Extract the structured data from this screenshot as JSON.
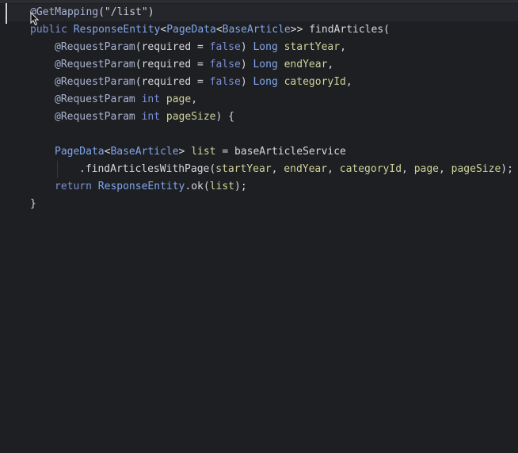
{
  "editor": {
    "language": "java",
    "lines": [
      {
        "tokens": [
          [
            "an",
            "@GetMapping"
          ],
          [
            "fn",
            "("
          ],
          [
            "st",
            "\"/list\""
          ],
          [
            "fn",
            ")"
          ]
        ]
      },
      {
        "tokens": [
          [
            "kw",
            "public "
          ],
          [
            "ty",
            "ResponseEntity"
          ],
          [
            "fn",
            "<"
          ],
          [
            "ty",
            "PageData"
          ],
          [
            "fn",
            "<"
          ],
          [
            "ty",
            "BaseArticle"
          ],
          [
            "fn",
            ">> findArticles("
          ]
        ]
      },
      {
        "indent": 1,
        "tokens": [
          [
            "an",
            "@RequestParam"
          ],
          [
            "fn",
            "(required = "
          ],
          [
            "kw",
            "false"
          ],
          [
            "fn",
            ") "
          ],
          [
            "ty",
            "Long "
          ],
          [
            "pa",
            "startYear"
          ],
          [
            "fn",
            ","
          ]
        ]
      },
      {
        "indent": 1,
        "tokens": [
          [
            "an",
            "@RequestParam"
          ],
          [
            "fn",
            "(required = "
          ],
          [
            "kw",
            "false"
          ],
          [
            "fn",
            ") "
          ],
          [
            "ty",
            "Long "
          ],
          [
            "pa",
            "endYear"
          ],
          [
            "fn",
            ","
          ]
        ]
      },
      {
        "indent": 1,
        "tokens": [
          [
            "an",
            "@RequestParam"
          ],
          [
            "fn",
            "(required = "
          ],
          [
            "kw",
            "false"
          ],
          [
            "fn",
            ") "
          ],
          [
            "ty",
            "Long "
          ],
          [
            "pa",
            "categoryId"
          ],
          [
            "fn",
            ","
          ]
        ]
      },
      {
        "indent": 1,
        "tokens": [
          [
            "an",
            "@RequestParam "
          ],
          [
            "kw",
            "int "
          ],
          [
            "pa",
            "page"
          ],
          [
            "fn",
            ","
          ]
        ]
      },
      {
        "indent": 1,
        "tokens": [
          [
            "an",
            "@RequestParam "
          ],
          [
            "kw",
            "int "
          ],
          [
            "pa",
            "pageSize"
          ],
          [
            "fn",
            ") {"
          ]
        ]
      },
      {
        "tokens": []
      },
      {
        "indent": 1,
        "tokens": [
          [
            "ty",
            "PageData"
          ],
          [
            "fn",
            "<"
          ],
          [
            "ty",
            "BaseArticle"
          ],
          [
            "fn",
            "> "
          ],
          [
            "pa",
            "list"
          ],
          [
            "fn",
            " = baseArticleService"
          ]
        ]
      },
      {
        "indent": 2,
        "guide": true,
        "tokens": [
          [
            "fn",
            ".findArticlesWithPage("
          ],
          [
            "pa",
            "startYear"
          ],
          [
            "fn",
            ", "
          ],
          [
            "pa",
            "endYear"
          ],
          [
            "fn",
            ", "
          ],
          [
            "pa",
            "categoryId"
          ],
          [
            "fn",
            ", "
          ],
          [
            "pa",
            "page"
          ],
          [
            "fn",
            ", "
          ],
          [
            "pa",
            "pageSize"
          ],
          [
            "fn",
            ");"
          ]
        ]
      },
      {
        "indent": 1,
        "tokens": [
          [
            "kw",
            "return "
          ],
          [
            "ty",
            "ResponseEntity"
          ],
          [
            "fn",
            ".ok("
          ],
          [
            "pa",
            "list"
          ],
          [
            "fn",
            ");"
          ]
        ]
      },
      {
        "tokens": [
          [
            "fn",
            "}"
          ]
        ]
      }
    ]
  }
}
